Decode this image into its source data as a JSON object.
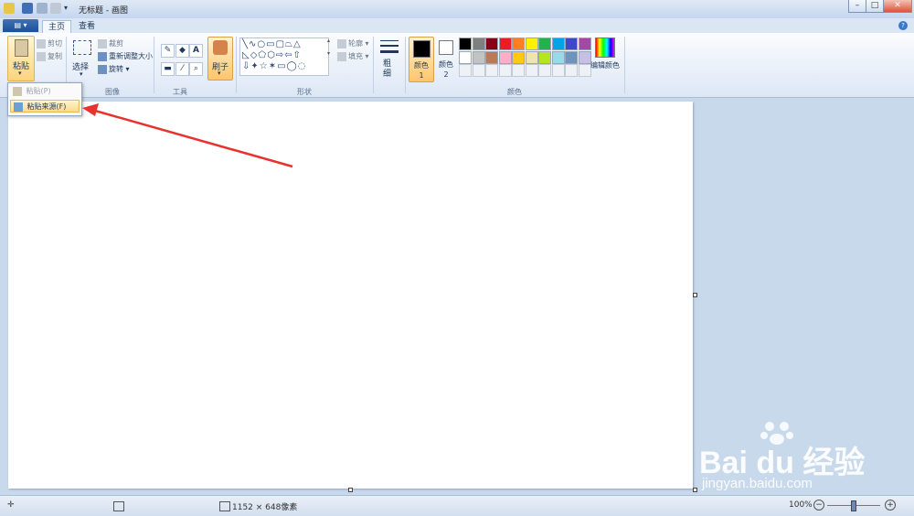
{
  "window": {
    "title": "无标题 - 画图",
    "minimize": "–",
    "maximize": "□",
    "close": "✕"
  },
  "tabs": {
    "file": "▤ ▾",
    "home": "主页",
    "view": "查看"
  },
  "clipboard": {
    "paste": "粘贴",
    "cut": "剪切",
    "copy": "复制",
    "label": "剪贴板"
  },
  "image": {
    "select": "选择",
    "crop": "裁剪",
    "resize": "重新调整大小",
    "rotate": "旋转",
    "label": "图像"
  },
  "tools": {
    "label": "工具",
    "brush": "刷子"
  },
  "shapes": {
    "outline": "轮廓",
    "fill": "填充",
    "label": "形状"
  },
  "size": {
    "label": "粗细"
  },
  "colors": {
    "color1": "颜色 1",
    "color2": "颜色 2",
    "edit": "编辑颜色",
    "label": "颜色",
    "palette_row1": [
      "#000000",
      "#7f7f7f",
      "#880015",
      "#ed1c24",
      "#ff7f27",
      "#fff200",
      "#22b14c",
      "#00a2e8",
      "#3f48cc",
      "#a349a4"
    ],
    "palette_row2": [
      "#ffffff",
      "#c3c3c3",
      "#b97a57",
      "#ffaec9",
      "#ffc90e",
      "#efe4b0",
      "#b5e61d",
      "#99d9ea",
      "#7092be",
      "#c8bfe7"
    ]
  },
  "dropdown": {
    "paste": "粘贴(P)",
    "paste_from": "粘贴来源(F)"
  },
  "status": {
    "dimensions": "1152 × 648像素",
    "zoom": "100%"
  },
  "watermark": {
    "brand": "Bai du 经验",
    "url": "jingyan.baidu.com"
  }
}
